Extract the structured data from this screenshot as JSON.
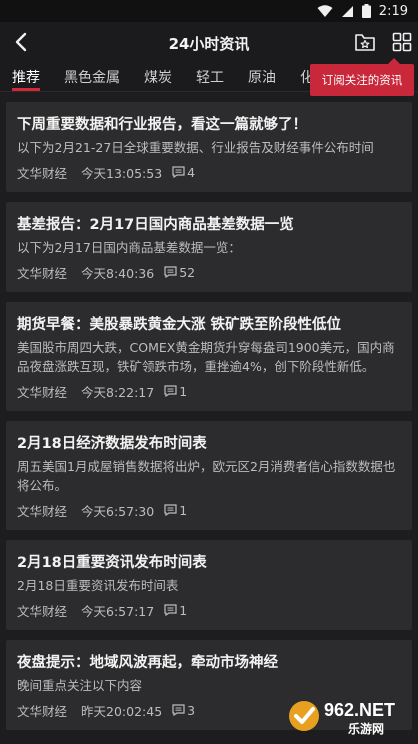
{
  "status_bar": {
    "time": "2:19"
  },
  "header": {
    "title": "24小时资讯"
  },
  "tabs": [
    {
      "label": "推荐",
      "active": true
    },
    {
      "label": "黑色金属",
      "active": false
    },
    {
      "label": "煤炭",
      "active": false
    },
    {
      "label": "轻工",
      "active": false
    },
    {
      "label": "原油",
      "active": false
    },
    {
      "label": "化工",
      "active": false
    }
  ],
  "tooltip": {
    "text": "订阅关注的资讯"
  },
  "articles": [
    {
      "title": "下周重要数据和行业报告，看这一篇就够了！",
      "summary": "以下为2月21-27日全球重要数据、行业报告及财经事件公布时间",
      "source": "文华财经",
      "time": "今天13:05:53",
      "comments": "4"
    },
    {
      "title": "基差报告：2月17日国内商品基差数据一览",
      "summary": "以下为2月17日国内商品基差数据一览：",
      "source": "文华财经",
      "time": "今天8:40:36",
      "comments": "52"
    },
    {
      "title": "期货早餐：美股暴跌黄金大涨 铁矿跌至阶段性低位",
      "summary": "美国股市周四大跌，COMEX黄金期货升穿每盎司1900美元，国内商品夜盘涨跌互现，铁矿领跌市场，重挫逾4%，创下阶段性新低。",
      "source": "文华财经",
      "time": "今天8:22:17",
      "comments": "1"
    },
    {
      "title": "2月18日经济数据发布时间表",
      "summary": "周五美国1月成屋销售数据将出炉，欧元区2月消费者信心指数数据也将公布。",
      "source": "文华财经",
      "time": "今天6:57:30",
      "comments": "1"
    },
    {
      "title": "2月18日重要资讯发布时间表",
      "summary": "2月18日重要资讯发布时间表",
      "source": "文华财经",
      "time": "今天6:57:17",
      "comments": "1"
    },
    {
      "title": "夜盘提示：地域风波再起，牵动市场神经",
      "summary": "晚间重点关注以下内容",
      "source": "文华财经",
      "time": "昨天20:02:45",
      "comments": "3"
    }
  ],
  "watermark": {
    "brand": "962.NET",
    "sub": "乐游网"
  },
  "colors": {
    "accent": "#d4283a",
    "card_bg": "#2c2c2e",
    "page_bg": "#1d1d1f"
  }
}
